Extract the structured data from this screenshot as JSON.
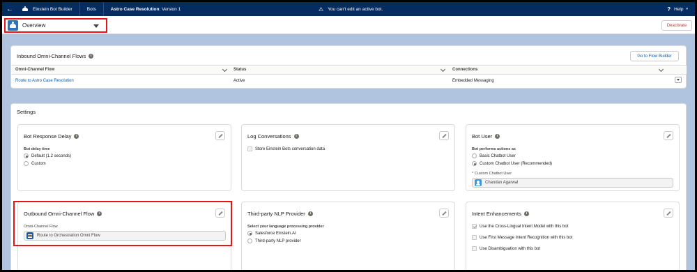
{
  "topbar": {
    "app_name": "Einstein Bot Builder",
    "nav_bots": "Bots",
    "bot_title": "Astro Case Resolution",
    "bot_version": " : Version 1",
    "warning": "You can't edit an active bot.",
    "help": "Help"
  },
  "toolbar": {
    "view_selected": "Overview",
    "deactivate_label": "Deactivate"
  },
  "inbound": {
    "title": "Inbound Omni-Channel Flows",
    "flow_builder_button": "Go to Flow Builder",
    "columns": [
      "Omni-Channel Flow",
      "Status",
      "Connections"
    ],
    "rows": [
      {
        "flow": "Route to Astro Case Resolution",
        "status": "Active",
        "connections": "Embedded Messaging"
      }
    ]
  },
  "settings": {
    "title": "Settings",
    "bot_response_delay": {
      "title": "Bot Response Delay",
      "field_label": "Bot delay time",
      "options": [
        "Default (1.2 seconds)",
        "Custom"
      ],
      "selected": "Default (1.2 seconds)"
    },
    "log_conversations": {
      "title": "Log Conversations",
      "checkbox_label": "Store Einstein Bots conversation data",
      "checked": false
    },
    "bot_user": {
      "title": "Bot User",
      "field_label": "Bot performs actions as",
      "options": [
        "Basic Chatbot User",
        "Custom Chatbot User (Recommended)"
      ],
      "selected": "Custom Chatbot User (Recommended)",
      "custom_user_label": "Custom Chatbot User",
      "custom_user_value": "Chandan Agarwal"
    },
    "outbound_flow": {
      "title": "Outbound Omni-Channel Flow",
      "field_label": "Omni-Channel Flow",
      "value": "Route to Orchestration Omni Flow"
    },
    "nlp_provider": {
      "title": "Third-party NLP Provider",
      "field_label": "Select your language processing provider",
      "options": [
        "Salesforce Einstein.AI",
        "Third-party NLP provider"
      ],
      "selected": "Salesforce Einstein.AI"
    },
    "intent_enhancements": {
      "title": "Intent Enhancements",
      "options": [
        {
          "label": "Use the Cross-Lingual Intent Model with this bot",
          "checked": true
        },
        {
          "label": "Use First Message Intent Recognition with this bot",
          "checked": false
        },
        {
          "label": "Use Disambiguation with this bot",
          "checked": false
        }
      ]
    }
  },
  "colors": {
    "header_bg": "#032d60",
    "page_bg": "#b0c4df",
    "link": "#0b5cab",
    "highlight_red": "#e3151b",
    "deactivate_text": "#c23934"
  }
}
